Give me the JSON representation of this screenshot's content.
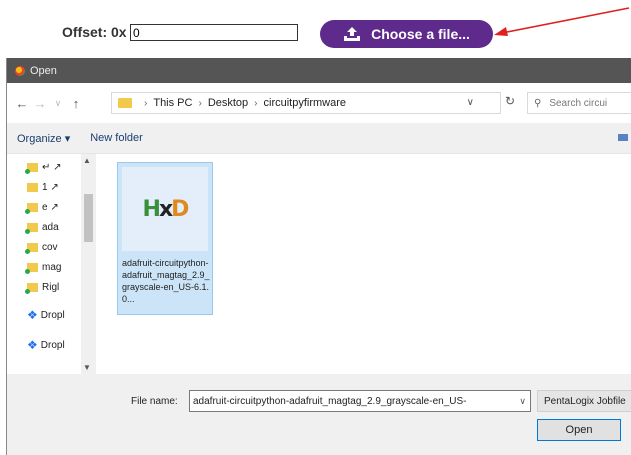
{
  "page": {
    "offset_label": "Offset: 0x",
    "offset_value": "0",
    "choose_file_label": "Choose a file...",
    "accent_color": "#5e2a8c",
    "arrow_color": "#e02020"
  },
  "dialog": {
    "title": "Open",
    "breadcrumb": [
      "This PC",
      "Desktop",
      "circuitpyfirmware"
    ],
    "search_placeholder": "Search circui",
    "toolbar": {
      "organize_label": "Organize ▾",
      "new_folder_label": "New folder"
    },
    "nav_items": [
      {
        "label": "↵ ↗",
        "icon": "folder-icon"
      },
      {
        "label": "1 ↗",
        "icon": "folder-icon"
      },
      {
        "label": "e ↗",
        "icon": "folder-icon"
      },
      {
        "label": "ada",
        "icon": "folder-icon"
      },
      {
        "label": "cov",
        "icon": "folder-icon"
      },
      {
        "label": "mag",
        "icon": "folder-icon"
      },
      {
        "label": "Rigl",
        "icon": "folder-icon"
      },
      {
        "label": "Dropl",
        "icon": "dropbox-icon"
      },
      {
        "label": "Dropl",
        "icon": "dropbox-icon"
      }
    ],
    "file": {
      "name": "adafruit-circuitpython-adafruit_magtag_2.9_grayscale-en_US-6.1.0...",
      "icon": "hxd-logo",
      "logo_text": "HxD"
    },
    "file_name_label": "File name:",
    "file_name_value": "adafruit-circuitpython-adafruit_magtag_2.9_grayscale-en_US-",
    "file_type": "PentaLogix Jobfile",
    "open_label": "Open"
  }
}
